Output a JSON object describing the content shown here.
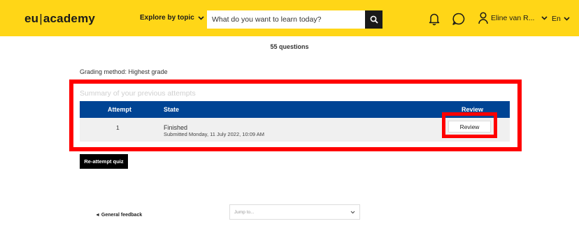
{
  "header": {
    "logo_left": "eu",
    "logo_sep": "|",
    "logo_right": "academy",
    "explore_label": "Explore by topic",
    "search_placeholder": "What do you want to learn today?",
    "user_name": "Eline van R...",
    "language": "En"
  },
  "quiz": {
    "questions_count": "55 questions",
    "grading_method": "Grading method: Highest grade",
    "summary_title": "Summary of your previous attempts",
    "columns": {
      "attempt": "Attempt",
      "state": "State",
      "review": "Review"
    },
    "rows": [
      {
        "attempt": "1",
        "state": "Finished",
        "submitted": "Submitted Monday, 11 July 2022, 10:09 AM",
        "review_label": "Review"
      }
    ],
    "reattempt_label": "Re-attempt quiz"
  },
  "footer": {
    "general_feedback": "◄ General feedback",
    "jump_placeholder": "Jump to..."
  },
  "colors": {
    "header_bg": "#ffd617",
    "table_head": "#004494",
    "highlight": "#ff0000"
  },
  "icons": [
    "chevron-down-icon",
    "search-icon",
    "bell-icon",
    "chat-icon",
    "user-icon"
  ]
}
